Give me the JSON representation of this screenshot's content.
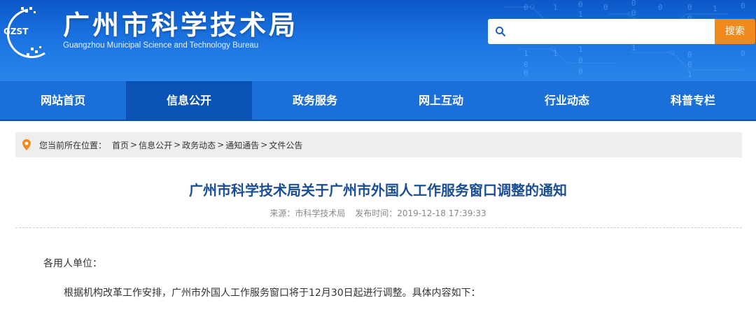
{
  "header": {
    "logo_text": "GZST",
    "title": "广州市科学技术局",
    "subtitle": "Guangzhou Municipal Science and Technology Bureau",
    "search_placeholder": "",
    "search_button": "搜索",
    "accent_color": "#f08a1c",
    "icons": [
      "gzst-logo-icon",
      "search-icon"
    ]
  },
  "nav": {
    "items": [
      {
        "label": "网站首页"
      },
      {
        "label": "信息公开"
      },
      {
        "label": "政务服务"
      },
      {
        "label": "网上互动"
      },
      {
        "label": "行业动态"
      },
      {
        "label": "科普专栏"
      }
    ],
    "active_index": 1
  },
  "breadcrumb": {
    "prefix": "您当前所在位置：",
    "items": [
      "首页",
      "信息公开",
      "政务动态",
      "通知通告",
      "文件公告"
    ],
    "separator": ">",
    "icon": "location-pin-icon"
  },
  "article": {
    "title": "广州市科学技术局关于广州市外国人工作服务窗口调整的通知",
    "source": "来源：市科学技术局",
    "published": "发布时间：2019-12-18 17:39:33",
    "salutation": "各用人单位：",
    "paragraph": "根据机构改革工作安排，广州市外国人工作服务窗口将于12月30日起进行调整。具体内容如下："
  }
}
